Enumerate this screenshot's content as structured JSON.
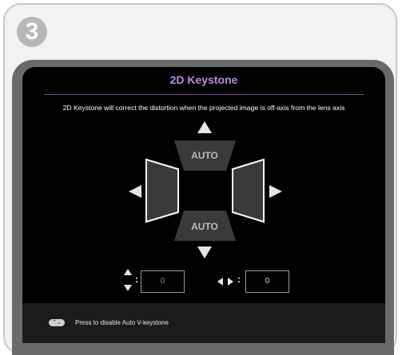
{
  "step": {
    "number": "3"
  },
  "dialog": {
    "title": "2D Keystone",
    "description": "2D Keystone will correct the distortion when the projected image is off-axis from the lens axis",
    "top_auto_label": "AUTO",
    "bottom_auto_label": "AUTO",
    "vertical_value": "0",
    "horizontal_value": "0",
    "vertical_symbol": ":",
    "horizontal_symbol": ":",
    "footer_text": "Press to disable Auto V-keystone"
  },
  "colors": {
    "title": "#b98ae6",
    "background": "#000000",
    "shape_fill": "#3a3a3a",
    "arrow": "#e0e0e0"
  },
  "icons": [
    "up-arrow-icon",
    "down-arrow-icon",
    "left-arrow-icon",
    "right-arrow-icon",
    "vertical-adjust-icon",
    "horizontal-adjust-icon",
    "remote-button-icon"
  ]
}
